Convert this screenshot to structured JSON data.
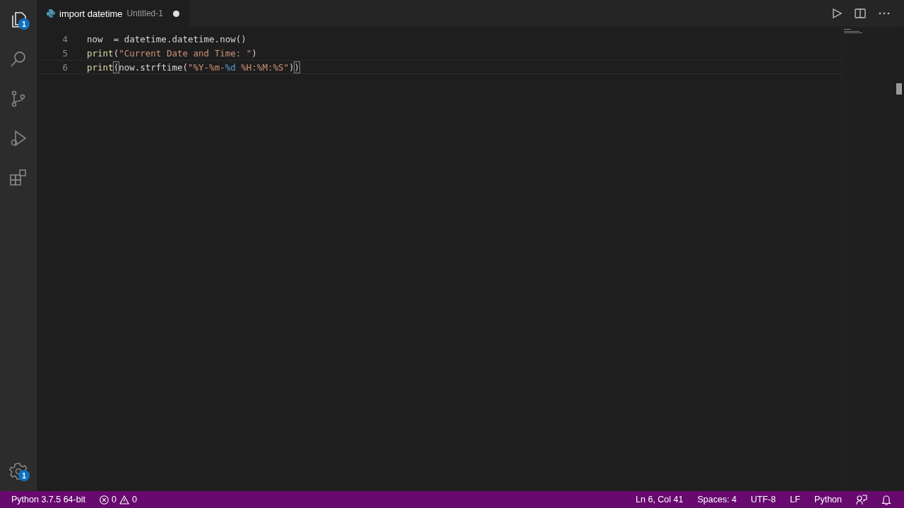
{
  "activity_bar": {
    "items": [
      {
        "kind": "files",
        "selected": true,
        "badge": "1"
      },
      {
        "kind": "search",
        "selected": false
      },
      {
        "kind": "source-control",
        "selected": false
      },
      {
        "kind": "run",
        "selected": false
      },
      {
        "kind": "extensions",
        "selected": false
      }
    ],
    "manage": {
      "badge": "1"
    }
  },
  "tab": {
    "title": "import datetime",
    "description": "Untitled-1",
    "dirty": true
  },
  "editor": {
    "lines": [
      {
        "number": "4",
        "current": false,
        "tokens": [
          {
            "kind": "plain",
            "text": "now  = datetime.datetime.now()"
          }
        ]
      },
      {
        "number": "5",
        "current": false,
        "tokens": [
          {
            "kind": "function",
            "text": "print"
          },
          {
            "kind": "plain",
            "text": "("
          },
          {
            "kind": "string",
            "text": "\"Current Date and Time: \""
          },
          {
            "kind": "plain",
            "text": ")"
          }
        ]
      },
      {
        "number": "6",
        "current": true,
        "tokens": [
          {
            "kind": "function",
            "text": "print"
          },
          {
            "kind": "bracket",
            "text": "("
          },
          {
            "kind": "plain",
            "text": "now.strftime("
          },
          {
            "kind": "string",
            "text": "\"%Y-%m-"
          },
          {
            "kind": "escape",
            "text": "%d"
          },
          {
            "kind": "string",
            "text": " %H:%M:%S\""
          },
          {
            "kind": "plain",
            "text": ")"
          },
          {
            "kind": "bracket",
            "text": ")"
          }
        ]
      }
    ]
  },
  "status_bar": {
    "left": [
      {
        "kind": "text",
        "text": "Python 3.7.5 64-bit"
      },
      {
        "kind": "problems",
        "errors": "0",
        "warnings": "0"
      }
    ],
    "right": [
      {
        "kind": "text",
        "text": "Ln 6, Col 41"
      },
      {
        "kind": "text",
        "text": "Spaces: 4"
      },
      {
        "kind": "text",
        "text": "UTF-8"
      },
      {
        "kind": "text",
        "text": "LF"
      },
      {
        "kind": "text",
        "text": "Python"
      },
      {
        "kind": "feedback"
      },
      {
        "kind": "bell"
      }
    ]
  }
}
